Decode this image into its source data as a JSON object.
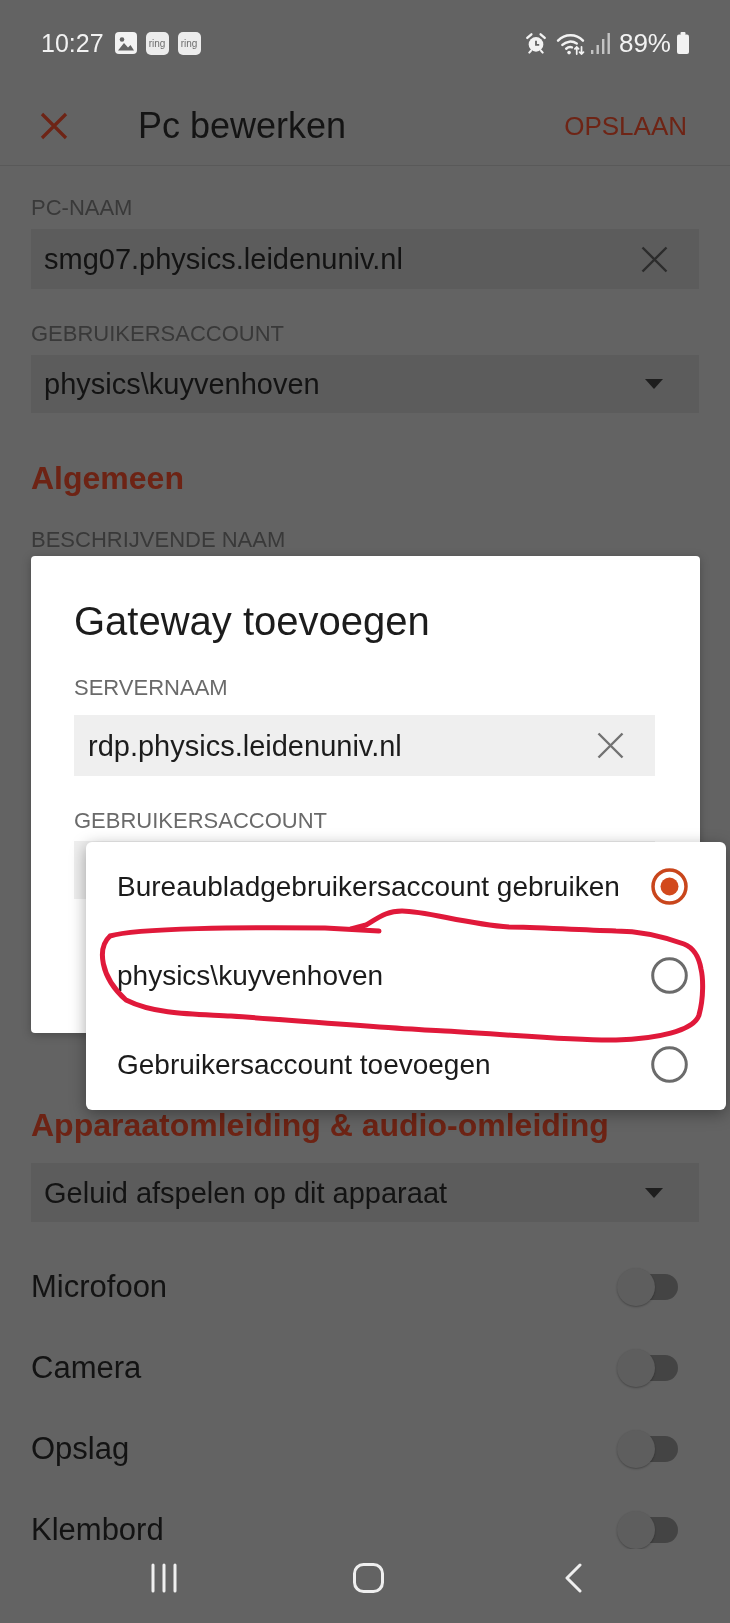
{
  "status_bar": {
    "time": "10:27",
    "notifications": [
      {
        "kind": "image"
      },
      {
        "kind": "app",
        "label": "ring"
      },
      {
        "kind": "app",
        "label": "ring"
      }
    ],
    "battery": "89%"
  },
  "app_bar": {
    "title": "Pc bewerken",
    "action": "OPSLAAN"
  },
  "pc_name": {
    "label": "PC-NAAM",
    "value": "smg07.physics.leidenuniv.nl"
  },
  "user_account": {
    "label": "GEBRUIKERSACCOUNT",
    "value": "physics\\kuyvenhoven"
  },
  "general": {
    "heading": "Algemeen",
    "fields": [
      {
        "label": "BESCHRIJVENDE NAAM"
      }
    ]
  },
  "dialog": {
    "title": "Gateway toevoegen",
    "server": {
      "label": "SERVERNAAM",
      "value": "rdp.physics.leidenuniv.nl"
    },
    "user_account": {
      "label": "GEBRUIKERSACCOUNT"
    },
    "menu": [
      {
        "label": "Bureaubladgebruikersaccount gebruiken",
        "selected": true,
        "circled": false
      },
      {
        "label": "physics\\kuyvenhoven",
        "selected": false,
        "circled": true
      },
      {
        "label": "Gebruikersaccount toevoegen",
        "selected": false,
        "circled": false
      }
    ]
  },
  "redirection": {
    "heading": "Apparaatomleiding & audio-omleiding",
    "audio": {
      "value": "Geluid afspelen op dit apparaat"
    },
    "toggles": [
      {
        "label": "Microfoon",
        "on": false
      },
      {
        "label": "Camera",
        "on": false
      },
      {
        "label": "Opslag",
        "on": false
      },
      {
        "label": "Klembord",
        "on": false
      }
    ]
  }
}
